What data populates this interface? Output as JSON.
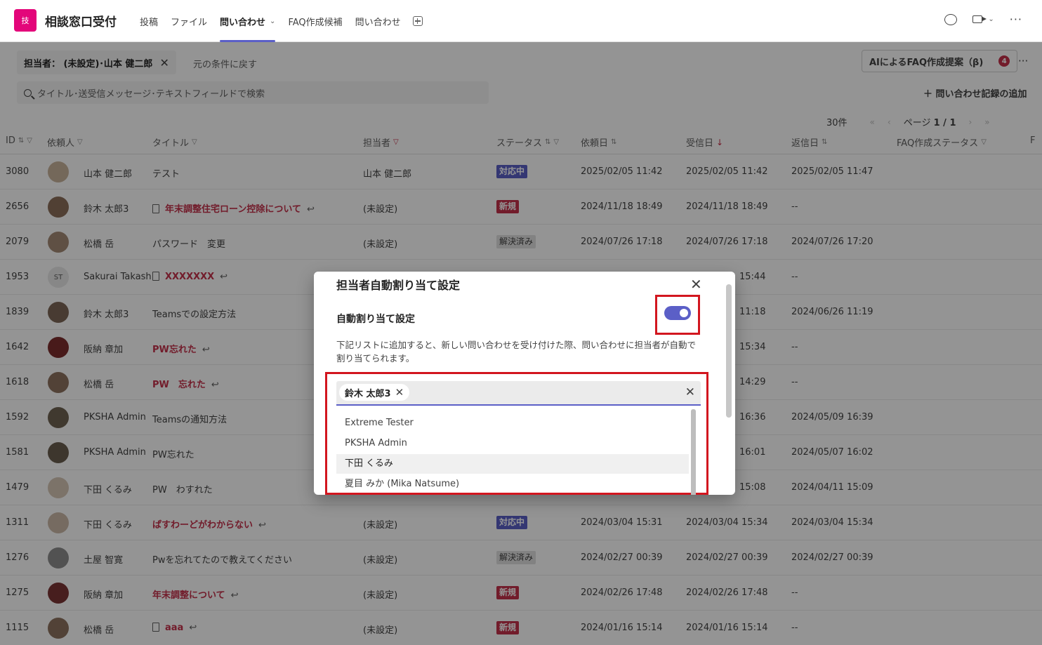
{
  "app": {
    "icon_text": "技",
    "title": "相談窓口受付",
    "brand_color": "#e3067a"
  },
  "tabs": [
    {
      "label": "投稿"
    },
    {
      "label": "ファイル"
    },
    {
      "label": "問い合わせ",
      "active": true
    },
    {
      "label": "FAQ作成候補"
    },
    {
      "label": "問い合わせ"
    }
  ],
  "filter": {
    "chip_label": "担当者： (未設定)･山本 健二郎",
    "reset_label": "元の条件に戻す"
  },
  "ai_button": {
    "label": "AIによるFAQ作成提案（β)",
    "count": "4"
  },
  "search": {
    "placeholder": "タイトル･送受信メッセージ･テキストフィールドで検索"
  },
  "add_record": "＋ 問い合わせ記録の追加",
  "pager": {
    "count": "30件",
    "page_label": "ページ",
    "page": "1 / 1"
  },
  "columns": [
    "ID",
    "依頼人",
    "タイトル",
    "担当者",
    "ステータス",
    "依頼日",
    "受信日",
    "返信日",
    "FAQ作成ステータス",
    "F"
  ],
  "rows": [
    {
      "id": "3080",
      "name": "山本 健二郎",
      "title": "テスト",
      "title_style": "plain",
      "assignee": "山本 健二郎",
      "status": "対応中",
      "status_type": "resp",
      "req": "2025/02/05 11:42",
      "recv": "2025/02/05 11:42",
      "reply": "2025/02/05 11:47"
    },
    {
      "id": "2656",
      "name": "鈴木 太郎3",
      "title": "年末調整住宅ローン控除について",
      "title_style": "link",
      "doc": true,
      "reply_icon": true,
      "assignee": "(未設定)",
      "status": "新規",
      "status_type": "new",
      "req": "2024/11/18 18:49",
      "recv": "2024/11/18 18:49",
      "reply": "--"
    },
    {
      "id": "2079",
      "name": "松橋 岳",
      "title": "パスワード　変更",
      "title_style": "plain",
      "assignee": "(未設定)",
      "status": "解決済み",
      "status_type": "done",
      "req": "2024/07/26 17:18",
      "recv": "2024/07/26 17:18",
      "reply": "2024/07/26 17:20"
    },
    {
      "id": "1953",
      "name": "Sakurai Takash",
      "initials": "ST",
      "title": "XXXXXXX",
      "title_style": "link",
      "doc": true,
      "reply_icon": true,
      "recv": "15:44",
      "reply": "--"
    },
    {
      "id": "1839",
      "name": "鈴木 太郎3",
      "title": "Teamsでの設定方法",
      "title_style": "plain",
      "recv": "11:18",
      "reply": "2024/06/26 11:19"
    },
    {
      "id": "1642",
      "name": "阪納 章加",
      "title": "PW忘れた",
      "title_style": "link",
      "reply_icon": true,
      "recv": "15:34",
      "reply": "--"
    },
    {
      "id": "1618",
      "name": "松橋 岳",
      "title": "PW　忘れた",
      "title_style": "link",
      "reply_icon": true,
      "recv": "14:29",
      "reply": "--"
    },
    {
      "id": "1592",
      "name": "PKSHA Admin",
      "title": "Teamsの通知方法",
      "title_style": "plain",
      "recv": "16:36",
      "reply": "2024/05/09 16:39"
    },
    {
      "id": "1581",
      "name": "PKSHA Admin",
      "title": "PW忘れた",
      "title_style": "plain",
      "recv": "16:01",
      "reply": "2024/05/07 16:02"
    },
    {
      "id": "1479",
      "name": "下田 くるみ",
      "title": "PW　わすれた",
      "title_style": "plain",
      "recv": "15:08",
      "reply": "2024/04/11 15:09"
    },
    {
      "id": "1311",
      "name": "下田 くるみ",
      "title": "ぱすわーどがわからない",
      "title_style": "link",
      "reply_icon": true,
      "assignee": "(未設定)",
      "status": "対応中",
      "status_type": "resp",
      "req": "2024/03/04 15:31",
      "recv": "2024/03/04 15:34",
      "reply": "2024/03/04 15:34"
    },
    {
      "id": "1276",
      "name": "土屋 智寛",
      "title": "Pwを忘れてたので教えてください",
      "title_style": "plain",
      "assignee": "(未設定)",
      "status": "解決済み",
      "status_type": "done",
      "req": "2024/02/27 00:39",
      "recv": "2024/02/27 00:39",
      "reply": "2024/02/27 00:39"
    },
    {
      "id": "1275",
      "name": "阪納 章加",
      "title": "年末調整について",
      "title_style": "link",
      "reply_icon": true,
      "assignee": "(未設定)",
      "status": "新規",
      "status_type": "new",
      "req": "2024/02/26 17:48",
      "recv": "2024/02/26 17:48",
      "reply": "--"
    },
    {
      "id": "1115",
      "name": "松橋 岳",
      "title": "aaa",
      "title_style": "link",
      "doc": true,
      "reply_icon": true,
      "assignee": "(未設定)",
      "status": "新規",
      "status_type": "new",
      "req": "2024/01/16 15:14",
      "recv": "2024/01/16 15:14",
      "reply": "--"
    }
  ],
  "dialog": {
    "title": "担当者自動割り当て設定",
    "toggle_label": "自動割り当て設定",
    "toggle_on": true,
    "description": "下記リストに追加すると、新しい問い合わせを受け付けた際、問い合わせに担当者が自動で割り当てられます。",
    "selected_chip": "鈴木 太郎3",
    "options": [
      "Extreme Tester",
      "PKSHA Admin",
      "下田 くるみ",
      "夏目 みか (Mika Natsume)"
    ],
    "hover_option_index": 2,
    "accent": "#5b5fc7",
    "highlight": "#d2161f"
  }
}
